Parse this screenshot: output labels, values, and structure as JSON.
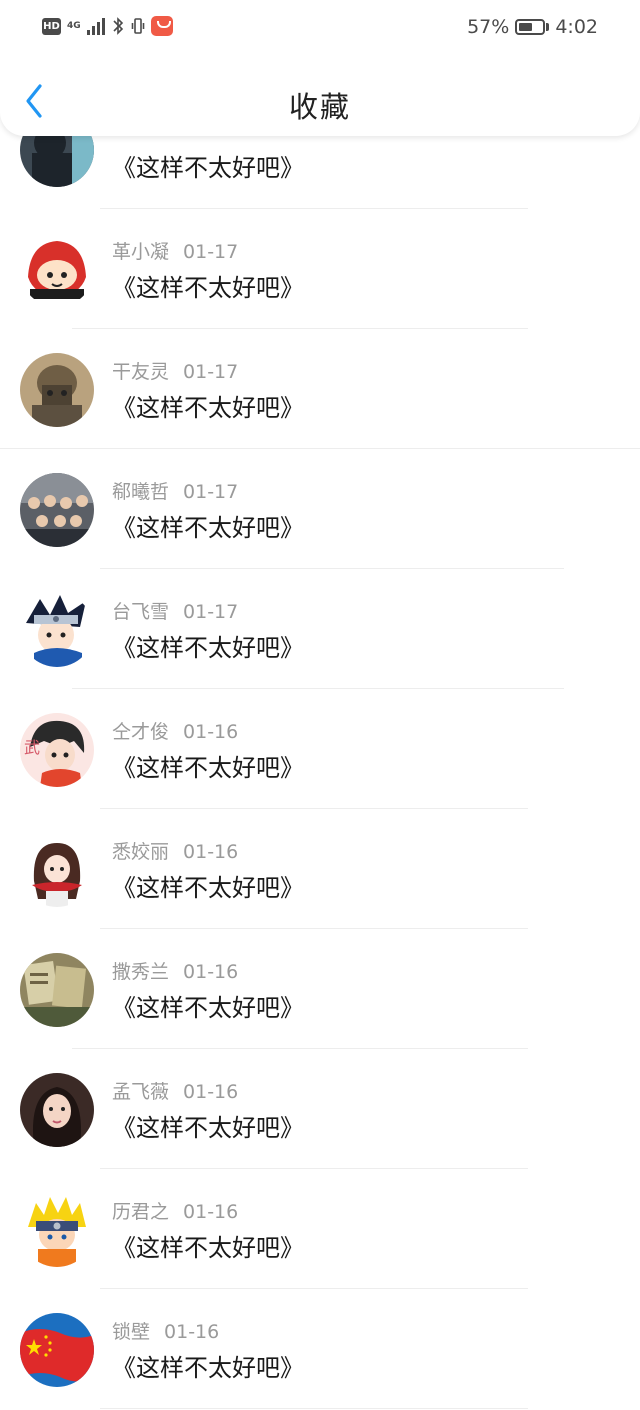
{
  "status_bar": {
    "hd_label": "HD",
    "network_type": "4G",
    "battery_percent": "57%",
    "battery_level": 0.57,
    "time": "4:02"
  },
  "nav": {
    "title": "收藏",
    "back_icon": "chevron-left-icon"
  },
  "colors": {
    "accent": "#2196f3",
    "meta": "#9a9a9a",
    "content": "#1a1a1a"
  },
  "items": [
    {
      "name": "",
      "date": "",
      "text": "《这样不太好吧》",
      "avatar": "dark-figure"
    },
    {
      "name": "革小凝",
      "date": "01-17",
      "text": "《这样不太好吧》",
      "avatar": "red-hood-cartoon"
    },
    {
      "name": "干友灵",
      "date": "01-17",
      "text": "《这样不太好吧》",
      "avatar": "soldier-helmet"
    },
    {
      "name": "郗曦哲",
      "date": "01-17",
      "text": "《这样不太好吧》",
      "avatar": "group-photo"
    },
    {
      "name": "台飞雪",
      "date": "01-17",
      "text": "《这样不太好吧》",
      "avatar": "ninja-headband"
    },
    {
      "name": "仝才俊",
      "date": "01-16",
      "text": "《这样不太好吧》",
      "avatar": "anime-boy"
    },
    {
      "name": "悉姣丽",
      "date": "01-16",
      "text": "《这样不太好吧》",
      "avatar": "anime-girl-scarf"
    },
    {
      "name": "撒秀兰",
      "date": "01-16",
      "text": "《这样不太好吧》",
      "avatar": "books-photo"
    },
    {
      "name": "孟飞薇",
      "date": "01-16",
      "text": "《这样不太好吧》",
      "avatar": "girl-portrait"
    },
    {
      "name": "历君之",
      "date": "01-16",
      "text": "《这样不太好吧》",
      "avatar": "blond-ninja"
    },
    {
      "name": "锁壁",
      "date": "01-16",
      "text": "《这样不太好吧》",
      "avatar": "red-flag"
    }
  ]
}
